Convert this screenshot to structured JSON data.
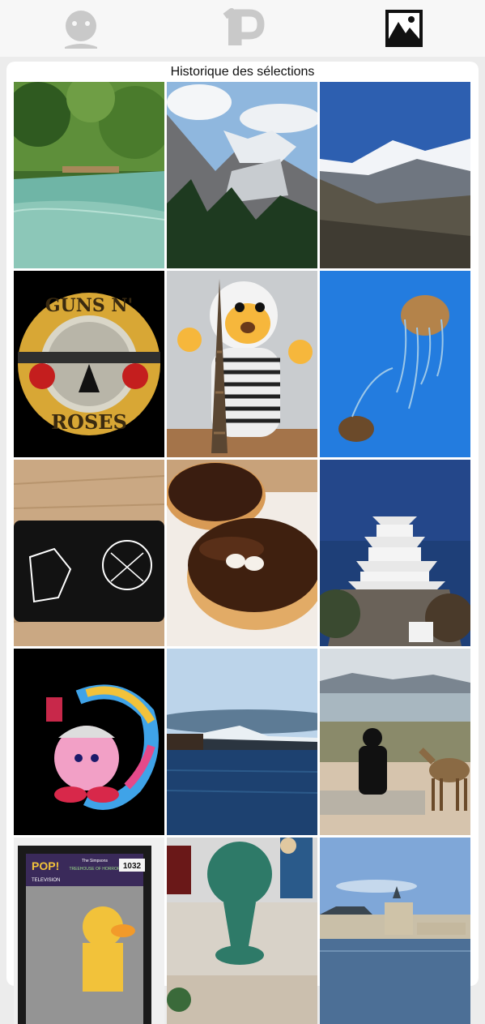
{
  "nav": {
    "items": [
      {
        "icon": "profile-icon",
        "active": false
      },
      {
        "icon": "1p-logo-icon",
        "active": false
      },
      {
        "icon": "gallery-icon",
        "active": true
      }
    ],
    "colors": {
      "inactive": "#c9c9c9",
      "active": "#111111"
    }
  },
  "history": {
    "title": "Historique des sélections",
    "photos": [
      {
        "subject": "turquoise river in jungle",
        "icon": "river-photo"
      },
      {
        "subject": "alpine glacier valley with pines",
        "icon": "glacier-valley-photo"
      },
      {
        "subject": "snowy mountain peak under blue sky",
        "icon": "snowy-peak-photo"
      },
      {
        "subject": "rock band logo with pistols and roses",
        "icon": "band-logo-photo",
        "logo_text": [
          "GUNS N'",
          "ROSES"
        ]
      },
      {
        "subject": "plush monkey with Eiffel tower figurine",
        "icon": "plush-monkey-photo"
      },
      {
        "subject": "jellyfish in blue aquarium",
        "icon": "jellyfish-photo"
      },
      {
        "subject": "black handheld console with creature artwork",
        "icon": "console-photo"
      },
      {
        "subject": "chocolate glazed donuts",
        "icon": "donuts-photo"
      },
      {
        "subject": "Japanese castle against dark blue sky",
        "icon": "castle-photo"
      },
      {
        "subject": "pink character with paint splash",
        "icon": "pink-character-photo"
      },
      {
        "subject": "lake at dusk with snowy mountain",
        "icon": "lake-mountain-photo"
      },
      {
        "subject": "person sitting by the sea with a deer",
        "icon": "deer-seaside-photo"
      },
      {
        "subject": "boxed vinyl figure",
        "icon": "vinyl-figure-photo",
        "box_text": [
          "POP!",
          "TELEVISION",
          "The Simpsons",
          "TREEHOUSE OF HORROR",
          "1032"
        ]
      },
      {
        "subject": "green figurine among collectibles",
        "icon": "figurines-photo"
      },
      {
        "subject": "chateau by a lake under blue sky",
        "icon": "chateau-photo"
      }
    ]
  }
}
